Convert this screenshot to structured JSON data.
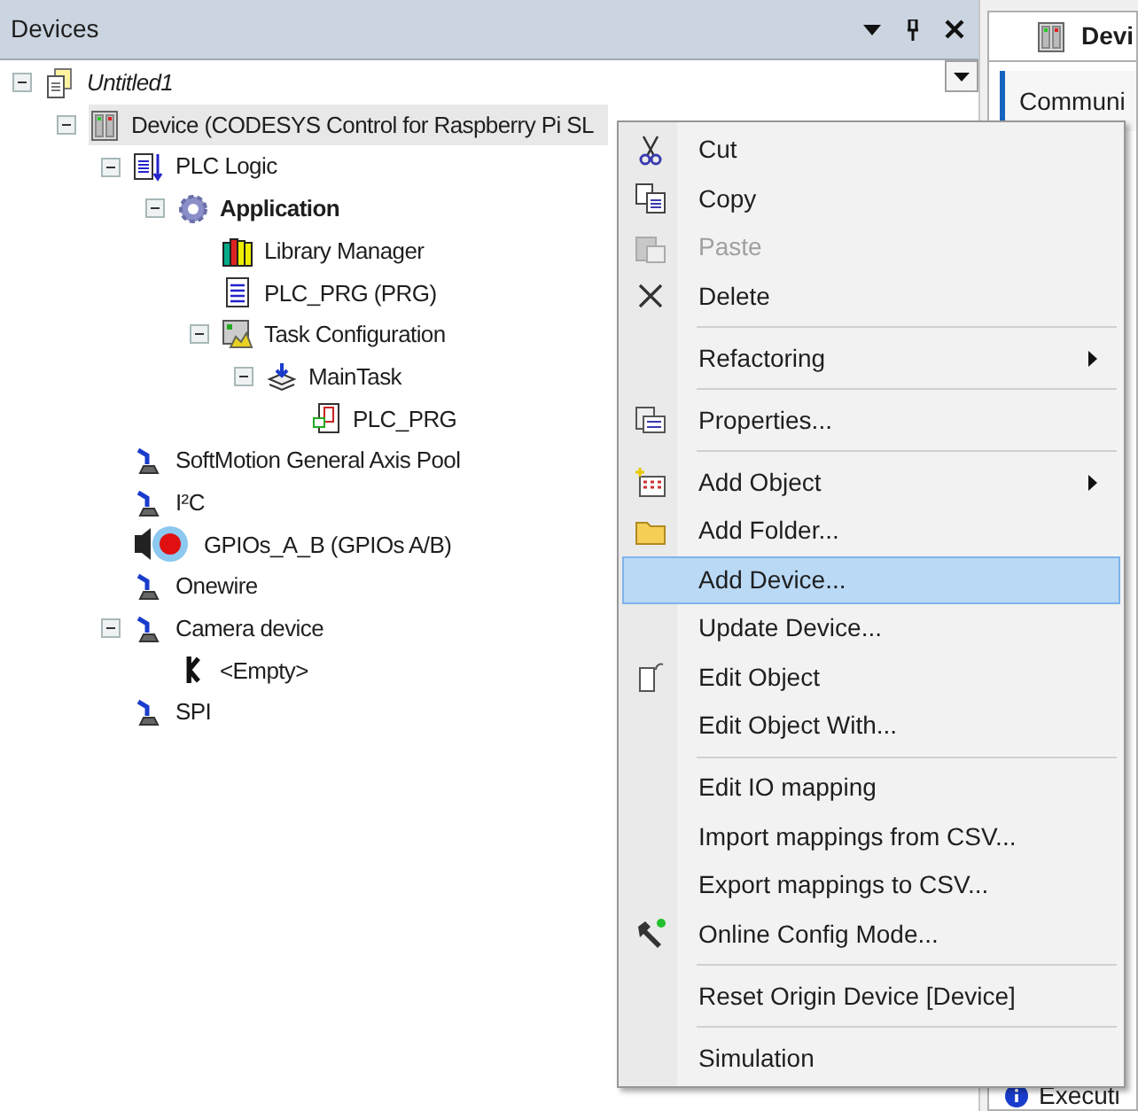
{
  "devices_panel": {
    "title": "Devices",
    "tree": [
      {
        "label": "Untitled1",
        "kind": "project",
        "expanded": true,
        "children": [
          {
            "label": "Device (CODESYS Control for Raspberry Pi SL",
            "kind": "device",
            "expanded": true,
            "highlighted": true,
            "children": [
              {
                "label": "PLC Logic",
                "kind": "plc-logic",
                "expanded": true,
                "children": [
                  {
                    "label": "Application",
                    "kind": "application",
                    "expanded": true,
                    "children": [
                      {
                        "label": "Library Manager",
                        "kind": "library"
                      },
                      {
                        "label": "PLC_PRG (PRG)",
                        "kind": "program"
                      },
                      {
                        "label": "Task Configuration",
                        "kind": "task-config",
                        "expanded": true,
                        "children": [
                          {
                            "label": "MainTask",
                            "kind": "task",
                            "expanded": true,
                            "children": [
                              {
                                "label": "PLC_PRG",
                                "kind": "pou"
                              }
                            ]
                          }
                        ]
                      }
                    ]
                  }
                ]
              },
              {
                "label": "SoftMotion General Axis Pool",
                "kind": "axis"
              },
              {
                "label": "I²C",
                "kind": "axis"
              },
              {
                "label": "GPIOs_A_B (GPIOs A/B)",
                "kind": "gpio"
              },
              {
                "label": "Onewire",
                "kind": "axis"
              },
              {
                "label": "Camera device",
                "kind": "axis",
                "expanded": true,
                "children": [
                  {
                    "label": "<Empty>",
                    "kind": "slot"
                  }
                ]
              },
              {
                "label": "SPI",
                "kind": "axis"
              }
            ]
          }
        ]
      }
    ]
  },
  "editor_panel": {
    "tab": "Devi",
    "section": "Communi",
    "status": "Executi"
  },
  "context_menu": [
    {
      "kind": "item",
      "label": "Cut",
      "disabled": false,
      "selected": false,
      "submenu": false
    },
    {
      "kind": "item",
      "label": "Copy",
      "disabled": false,
      "selected": false,
      "submenu": false
    },
    {
      "kind": "item",
      "label": "Paste",
      "disabled": true,
      "selected": false,
      "submenu": false
    },
    {
      "kind": "item",
      "label": "Delete",
      "disabled": false,
      "selected": false,
      "submenu": false
    },
    {
      "kind": "separator"
    },
    {
      "kind": "item",
      "label": "Refactoring",
      "disabled": false,
      "selected": false,
      "submenu": true
    },
    {
      "kind": "separator"
    },
    {
      "kind": "item",
      "label": "Properties...",
      "disabled": false,
      "selected": false,
      "submenu": false
    },
    {
      "kind": "separator"
    },
    {
      "kind": "item",
      "label": "Add Object",
      "disabled": false,
      "selected": false,
      "submenu": true
    },
    {
      "kind": "item",
      "label": "Add Folder...",
      "disabled": false,
      "selected": false,
      "submenu": false
    },
    {
      "kind": "item",
      "label": "Add Device...",
      "disabled": false,
      "selected": true,
      "submenu": false
    },
    {
      "kind": "item",
      "label": "Update Device...",
      "disabled": false,
      "selected": false,
      "submenu": false
    },
    {
      "kind": "item",
      "label": "Edit Object",
      "disabled": false,
      "selected": false,
      "submenu": false
    },
    {
      "kind": "item",
      "label": "Edit Object With...",
      "disabled": false,
      "selected": false,
      "submenu": false
    },
    {
      "kind": "separator"
    },
    {
      "kind": "item",
      "label": "Edit IO mapping",
      "disabled": false,
      "selected": false,
      "submenu": false
    },
    {
      "kind": "item",
      "label": "Import mappings from CSV...",
      "disabled": false,
      "selected": false,
      "submenu": false
    },
    {
      "kind": "item",
      "label": "Export mappings to CSV...",
      "disabled": false,
      "selected": false,
      "submenu": false
    },
    {
      "kind": "item",
      "label": "Online Config Mode...",
      "disabled": false,
      "selected": false,
      "submenu": false
    },
    {
      "kind": "separator"
    },
    {
      "kind": "item",
      "label": "Reset Origin Device [Device]",
      "disabled": false,
      "selected": false,
      "submenu": false
    },
    {
      "kind": "separator"
    },
    {
      "kind": "item",
      "label": "Simulation",
      "disabled": false,
      "selected": false,
      "submenu": false
    }
  ]
}
